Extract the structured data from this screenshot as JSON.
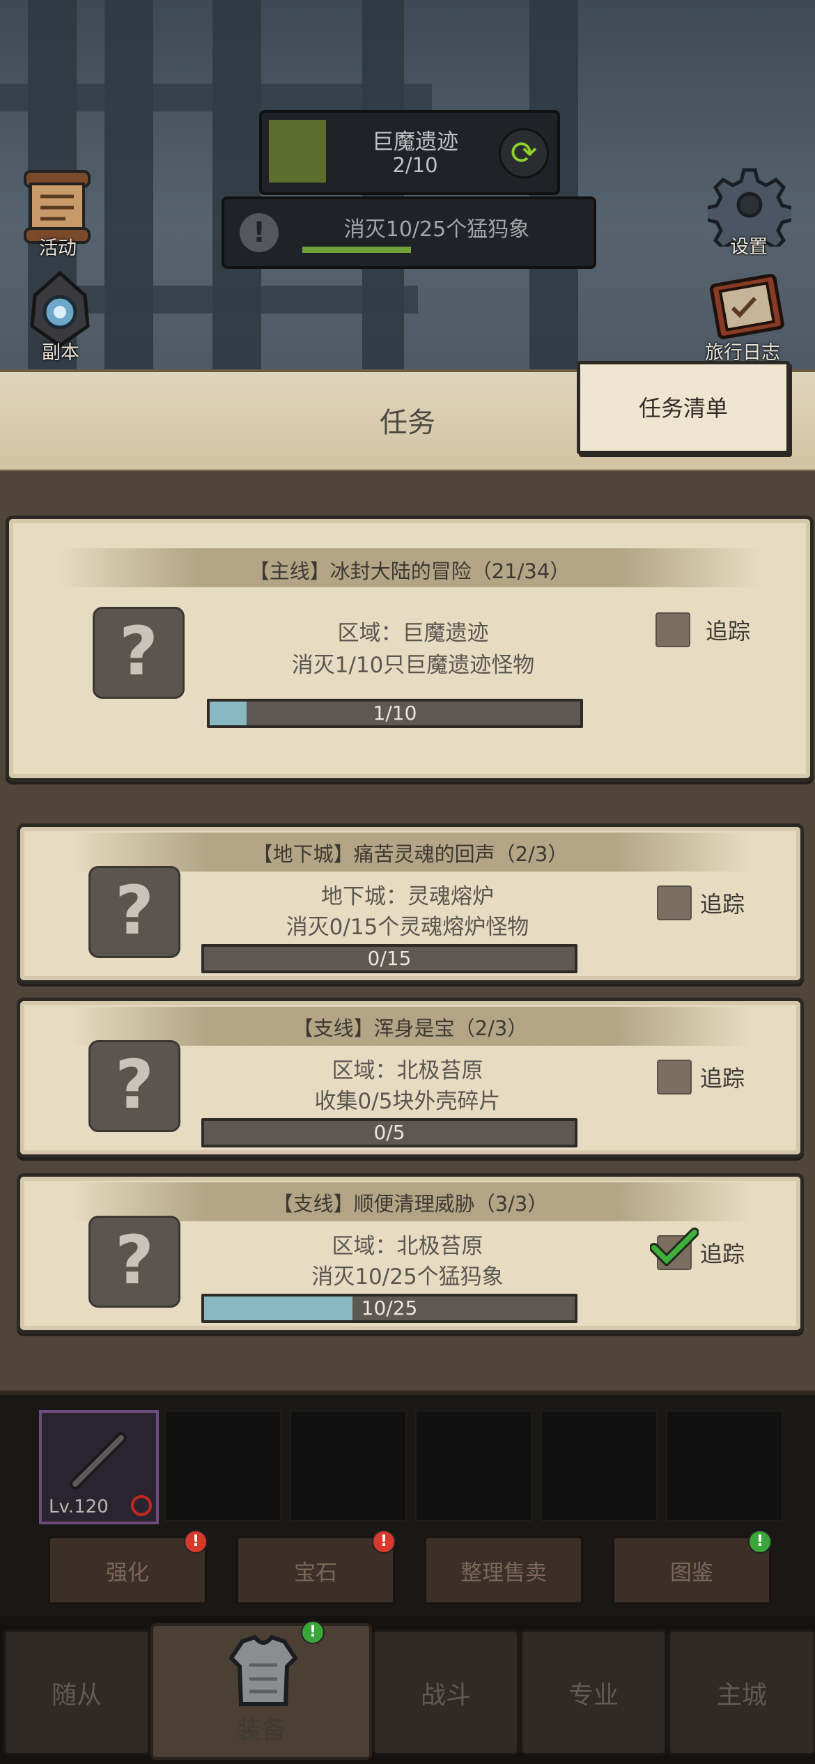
{
  "zone": {
    "name": "巨魔遗迹",
    "progress": "2/10",
    "swatch_color": "#5c6d2c"
  },
  "tracked_quest": {
    "text": "消灭10/25个猛犸象",
    "progress_fraction": 0.4
  },
  "side_buttons": {
    "activity": "活动",
    "dungeon": "副本",
    "settings": "设置",
    "travel_log": "旅行日志"
  },
  "tabs": {
    "title": "任务",
    "task_list": "任务清单"
  },
  "track_label": "追踪",
  "quests": [
    {
      "title": "【主线】冰封大陆的冒险（21/34）",
      "line1": "区域：巨魔遗迹",
      "line2": "消灭1/10只巨魔遗迹怪物",
      "progress_text": "1/10",
      "progress_fraction": 0.1,
      "tracked": false
    },
    {
      "title": "【地下城】痛苦灵魂的回声（2/3）",
      "line1": "地下城：灵魂熔炉",
      "line2": "消灭0/15个灵魂熔炉怪物",
      "progress_text": "0/15",
      "progress_fraction": 0.0,
      "tracked": false
    },
    {
      "title": "【支线】浑身是宝（2/3）",
      "line1": "区域：北极苔原",
      "line2": "收集0/5块外壳碎片",
      "progress_text": "0/5",
      "progress_fraction": 0.0,
      "tracked": false
    },
    {
      "title": "【支线】顺便清理威胁（3/3）",
      "line1": "区域：北极苔原",
      "line2": "消灭10/25个猛犸象",
      "progress_text": "10/25",
      "progress_fraction": 0.4,
      "tracked": true
    }
  ],
  "inventory": {
    "item_level": "Lv.120"
  },
  "actions": {
    "enhance": "强化",
    "gem": "宝石",
    "sort_sell": "整理售卖",
    "codex": "图鉴",
    "alert_glyph": "!"
  },
  "nav": {
    "followers": "随从",
    "equipment": "装备",
    "battle": "战斗",
    "profession": "专业",
    "main_city": "主城"
  },
  "colors": {
    "progress_fill": "#8ab8c2",
    "card_bg": "#e7dcc2",
    "check_green": "#3fae3c",
    "alert_red": "#d73a2c",
    "alert_green": "#3aa63a"
  }
}
